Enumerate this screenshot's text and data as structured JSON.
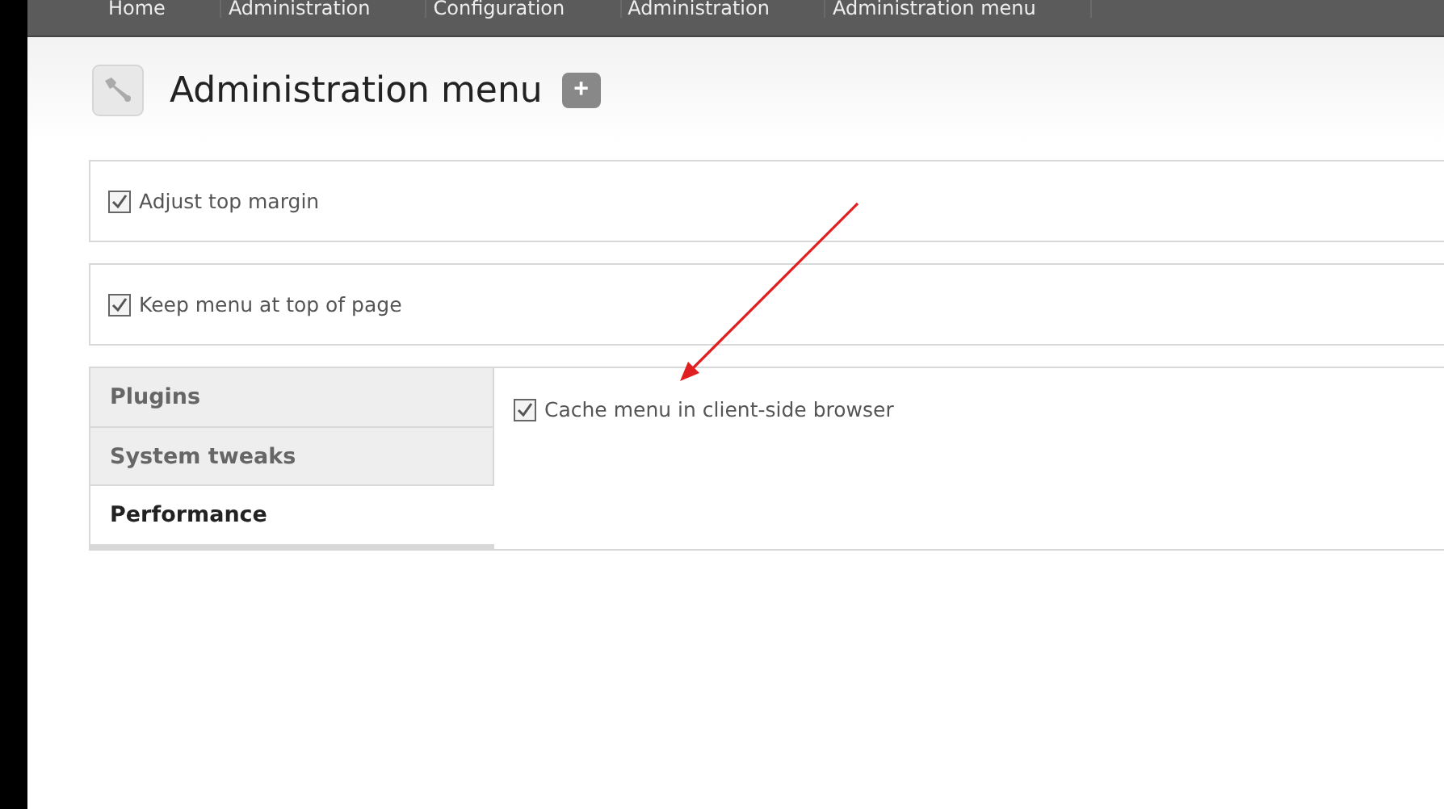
{
  "breadcrumb": [
    "Home",
    "Administration",
    "Configuration",
    "Administration",
    "Administration menu"
  ],
  "page": {
    "title": "Administration menu",
    "add_button": "+"
  },
  "settings": [
    {
      "label": "Adjust top margin",
      "checked": true
    },
    {
      "label": "Keep menu at top of page",
      "checked": true
    }
  ],
  "vertical_tabs": [
    {
      "label": "Plugins",
      "selected": false
    },
    {
      "label": "System tweaks",
      "selected": false
    },
    {
      "label": "Performance",
      "selected": true
    }
  ],
  "pane_settings": [
    {
      "label": "Cache menu in client-side browser",
      "checked": true
    }
  ]
}
